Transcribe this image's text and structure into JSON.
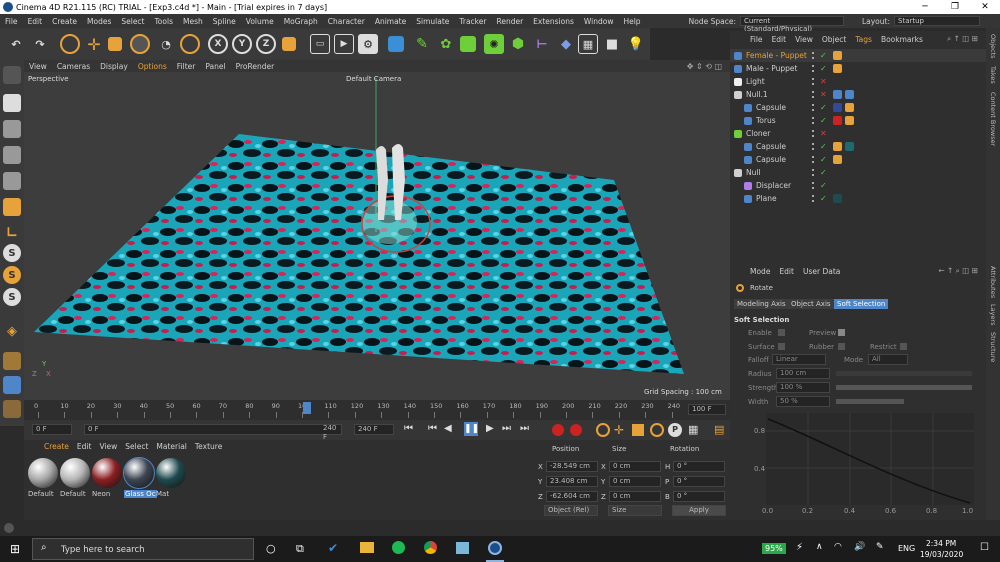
{
  "window": {
    "title": "Cinema 4D R21.115 (RC) TRIAL - [Exp3.c4d *] - Main - [Trial expires in 7 days]",
    "controls": [
      "─",
      "❐",
      "✕"
    ]
  },
  "menu": [
    "File",
    "Edit",
    "Create",
    "Modes",
    "Select",
    "Tools",
    "Mesh",
    "Spline",
    "Volume",
    "MoGraph",
    "Character",
    "Animate",
    "Simulate",
    "Tracker",
    "Render",
    "Extensions",
    "Window",
    "Help"
  ],
  "node_space": {
    "label": "Node Space:",
    "value": "Current (Standard/Physical)"
  },
  "layout": {
    "label": "Layout:",
    "value": "Startup"
  },
  "toolbar_letters": {
    "x": "X",
    "y": "Y",
    "z": "Z"
  },
  "left_tools": {
    "s1": "S",
    "s2": "S",
    "s3": "S"
  },
  "viewport": {
    "menu": [
      "View",
      "Cameras",
      "Display",
      "Options",
      "Filter",
      "Panel",
      "ProRender"
    ],
    "name": "Perspective",
    "camera": "Default Camera",
    "grid_spacing": "Grid Spacing : 100 cm",
    "axis": {
      "y": "Y",
      "z": "Z",
      "x": "X"
    }
  },
  "timeline": {
    "ticks": [
      "0",
      "10",
      "20",
      "30",
      "40",
      "50",
      "60",
      "70",
      "80",
      "90",
      "100",
      "110",
      "120",
      "130",
      "140",
      "150",
      "160",
      "170",
      "180",
      "190",
      "200",
      "210",
      "220",
      "230",
      "240"
    ],
    "current_frame": "100 F",
    "start": "0 F",
    "start2": "0 F",
    "end": "240 F",
    "end2": "240 F"
  },
  "materials": {
    "menu": [
      "Create",
      "Edit",
      "View",
      "Select",
      "Material",
      "Texture"
    ],
    "items": [
      {
        "name": "Default",
        "color": "#a8a8a8"
      },
      {
        "name": "Default",
        "color": "#b5b5b5"
      },
      {
        "name": "Neon",
        "color": "#8b1f22"
      },
      {
        "name": "Glass Oc",
        "color": "#3d4553"
      },
      {
        "name": "Mat",
        "color": "#1f4a4e"
      }
    ]
  },
  "coords": {
    "headers": [
      "Position",
      "Size",
      "Rotation"
    ],
    "rows": [
      {
        "axis": "X",
        "pos": "-28.549 cm",
        "saxis": "X",
        "size": "0 cm",
        "raxis": "H",
        "rot": "0 °"
      },
      {
        "axis": "Y",
        "pos": "23.408 cm",
        "saxis": "Y",
        "size": "0 cm",
        "raxis": "P",
        "rot": "0 °"
      },
      {
        "axis": "Z",
        "pos": "-62.604 cm",
        "saxis": "Z",
        "size": "0 cm",
        "raxis": "B",
        "rot": "0 °"
      }
    ],
    "mode": "Object (Rel)",
    "size_mode": "Size",
    "apply": "Apply"
  },
  "objects": {
    "menu": [
      "File",
      "Edit",
      "View",
      "Object",
      "Tags",
      "Bookmarks"
    ],
    "items": [
      {
        "name": "Female - Puppet",
        "color": "#e8a23a"
      },
      {
        "name": "Male - Puppet",
        "color": "#cfcfcf"
      },
      {
        "name": "Light",
        "color": "#cfcfcf"
      },
      {
        "name": "Null.1",
        "color": "#cfcfcf"
      },
      {
        "name": "Capsule",
        "color": "#cfcfcf"
      },
      {
        "name": "Torus",
        "color": "#cfcfcf"
      },
      {
        "name": "Cloner",
        "color": "#cfcfcf"
      },
      {
        "name": "Capsule",
        "color": "#cfcfcf"
      },
      {
        "name": "Capsule",
        "color": "#cfcfcf"
      },
      {
        "name": "Null",
        "color": "#cfcfcf"
      },
      {
        "name": "Displacer",
        "color": "#cfcfcf"
      },
      {
        "name": "Plane",
        "color": "#cfcfcf"
      }
    ]
  },
  "attributes": {
    "menu": [
      "Mode",
      "Edit",
      "User Data"
    ],
    "tool": "Rotate",
    "tabs": [
      "Modeling Axis",
      "Object Axis",
      "Soft Selection"
    ],
    "section": "Soft Selection",
    "enable": "Enable",
    "preview": "Preview",
    "surface": "Surface",
    "rubber": "Rubber",
    "restrict": "Restrict",
    "falloff_label": "Falloff",
    "falloff_value": "Linear",
    "mode_label": "Mode",
    "mode_value": "All",
    "radius_label": "Radius",
    "radius_value": "100 cm",
    "strength_label": "Strength",
    "strength_value": "100 %",
    "width_label": "Width",
    "width_value": "50 %",
    "graph_y": [
      "0.8",
      "0.4"
    ],
    "graph_x": [
      "0.0",
      "0.2",
      "0.4",
      "0.6",
      "0.8",
      "1.0"
    ]
  },
  "right_tabs": [
    "Objects",
    "Takes",
    "Content Browser",
    "Attributes",
    "Layers",
    "Structure"
  ],
  "taskbar": {
    "search_placeholder": "Type here to search",
    "battery": "95%",
    "language": "ENG",
    "time": "2:34 PM",
    "date": "19/03/2020"
  }
}
